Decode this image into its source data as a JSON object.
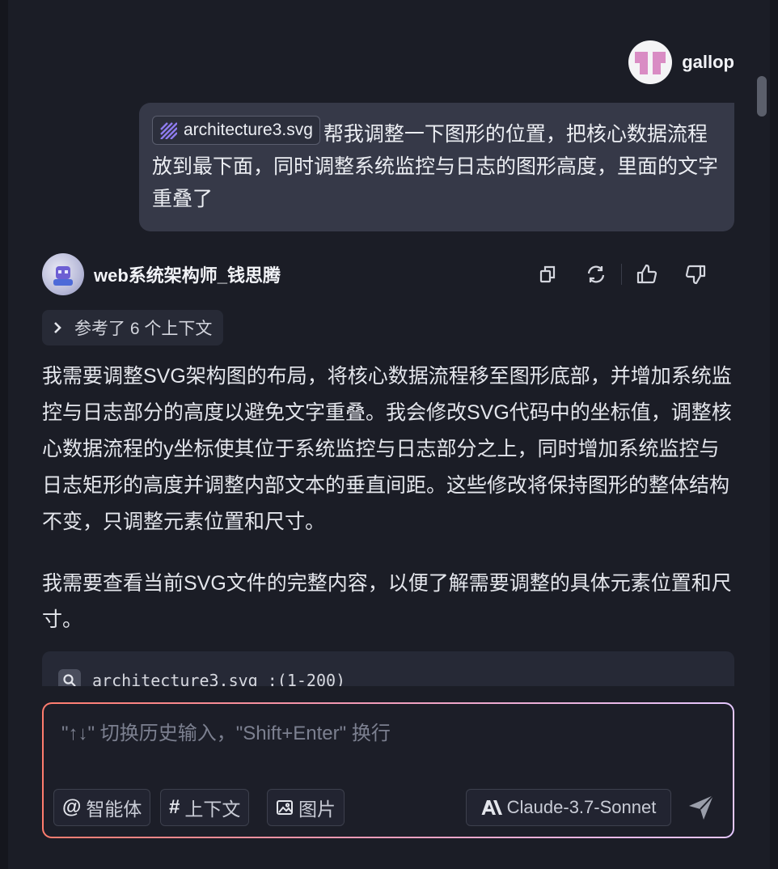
{
  "user": {
    "name": "gallop",
    "attachment": "architecture3.svg",
    "message": "帮我调整一下图形的位置，把核心数据流程放到最下面，同时调整系统监控与日志的图形高度，里面的文字重叠了"
  },
  "assistant": {
    "name": "web系统架构师_钱思腾",
    "context_label": "参考了 6 个上下文",
    "paragraphs": [
      "我需要调整SVG架构图的布局，将核心数据流程移至图形底部，并增加系统监控与日志部分的高度以避免文字重叠。我会修改SVG代码中的坐标值，调整核心数据流程的y坐标使其位于系统监控与日志部分之上，同时增加系统监控与日志矩形的高度并调整内部文本的垂直间距。这些修改将保持图形的整体结构不变，只调整元素位置和尺寸。",
      "我需要查看当前SVG文件的完整内容，以便了解需要调整的具体元素位置和尺寸。"
    ],
    "tool_call": "architecture3.svg :(1-200)",
    "actions": [
      "copy-icon",
      "refresh-icon",
      "thumbs-up-icon",
      "thumbs-down-icon"
    ]
  },
  "composer": {
    "placeholder": "\"↑↓\" 切换历史输入，\"Shift+Enter\" 换行",
    "agent_symbol": "@",
    "agent_label": "智能体",
    "context_symbol": "#",
    "context_label": "上下文",
    "image_label": "图片",
    "model_label": "Claude-3.7-Sonnet"
  },
  "colors": {
    "background": "#1b1d26",
    "bubble": "#363948",
    "accent_gradient_start": "#ff7c6e",
    "accent_gradient_end": "#e5c7ff"
  }
}
